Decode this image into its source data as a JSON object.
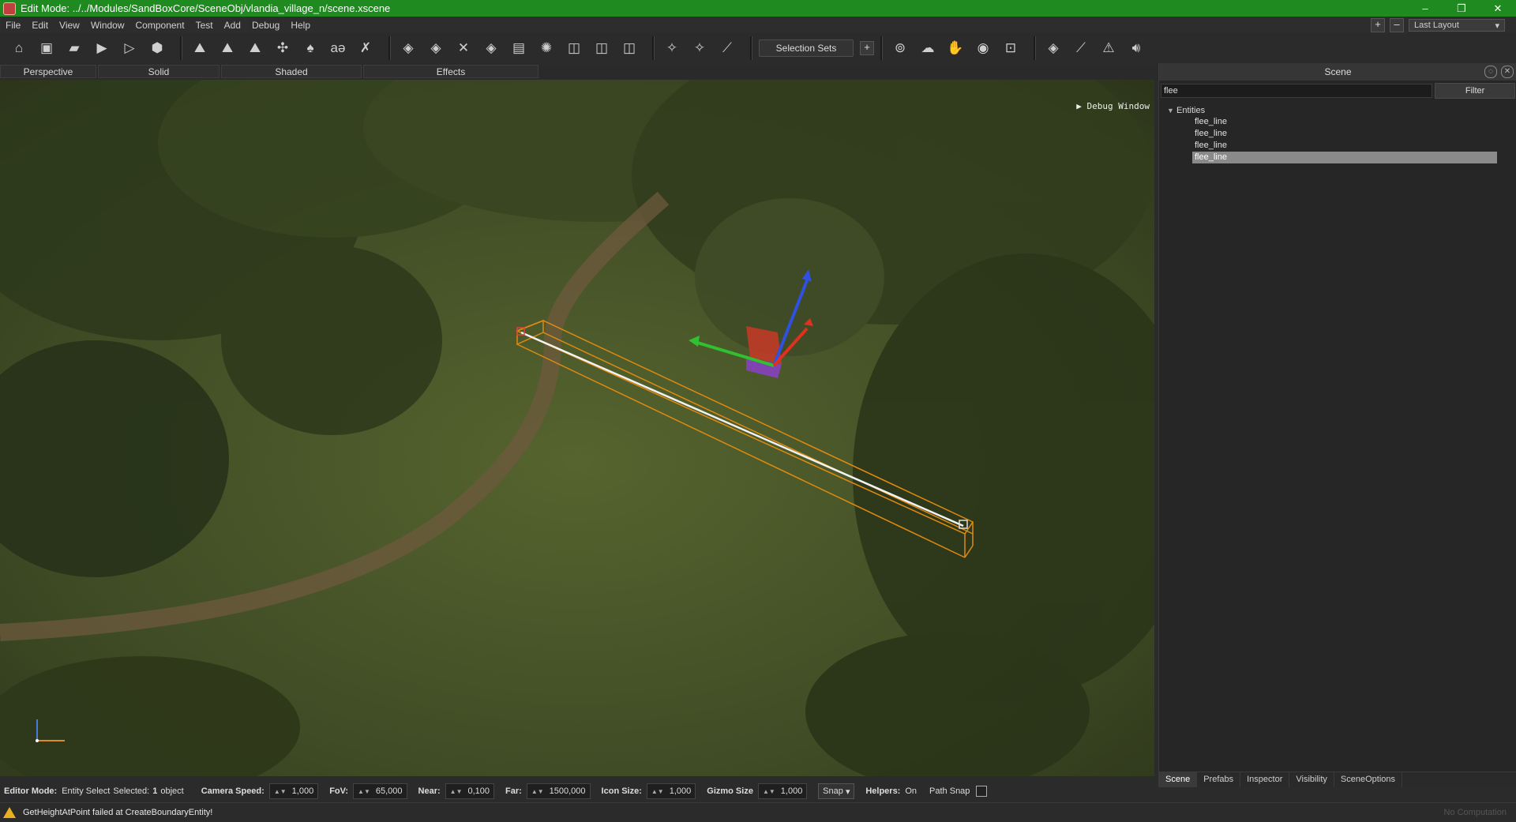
{
  "window": {
    "title": "Edit Mode: ../../Modules/SandBoxCore/SceneObj/vlandia_village_n/scene.xscene",
    "controls": [
      "–",
      "❐",
      "✕"
    ]
  },
  "menu": {
    "items": [
      "File",
      "Edit",
      "View",
      "Window",
      "Component",
      "Test",
      "Add",
      "Debug",
      "Help"
    ],
    "layout_value": "Last Layout",
    "plus": "+",
    "minus": "–"
  },
  "toolbar": {
    "selection_sets_label": "Selection Sets",
    "add_label": "+"
  },
  "viewport_modes": [
    "Perspective",
    "Solid",
    "Shaded",
    "Effects"
  ],
  "viewport": {
    "debug_window_label": "Debug Window"
  },
  "scene_panel": {
    "title": "Scene",
    "search_value": "flee",
    "filter_label": "Filter",
    "root_label": "Entities",
    "items": [
      "flee_line",
      "flee_line",
      "flee_line",
      "flee_line"
    ],
    "selected_index": 3,
    "tabs": [
      "Scene",
      "Prefabs",
      "Inspector",
      "Visibility",
      "SceneOptions"
    ],
    "active_tab": "Scene"
  },
  "status": {
    "editor_mode_label": "Editor Mode:",
    "editor_mode_value": "Entity Select",
    "selected_label": "Selected:",
    "selected_count": "1",
    "selected_unit": "object",
    "camera_speed_label": "Camera Speed:",
    "camera_speed": "1,000",
    "fov_label": "FoV:",
    "fov": "65,000",
    "near_label": "Near:",
    "near": "0,100",
    "far_label": "Far:",
    "far": "1500,000",
    "icon_size_label": "Icon Size:",
    "icon_size": "1,000",
    "gizmo_size_label": "Gizmo Size",
    "gizmo_size": "1,000",
    "snap_label": "Snap",
    "helpers_label": "Helpers:",
    "helpers_value": "On",
    "path_snap_label": "Path Snap"
  },
  "message": {
    "text": "GetHeightAtPoint failed at CreateBoundaryEntity!",
    "right_text": "No Computation"
  },
  "colors": {
    "titlebar": "#1f8a1f",
    "selection_box": "#e08a10",
    "gizmo_x": "#e03020",
    "gizmo_y": "#30c030",
    "gizmo_z": "#3050e0",
    "warning": "#e8b020"
  }
}
